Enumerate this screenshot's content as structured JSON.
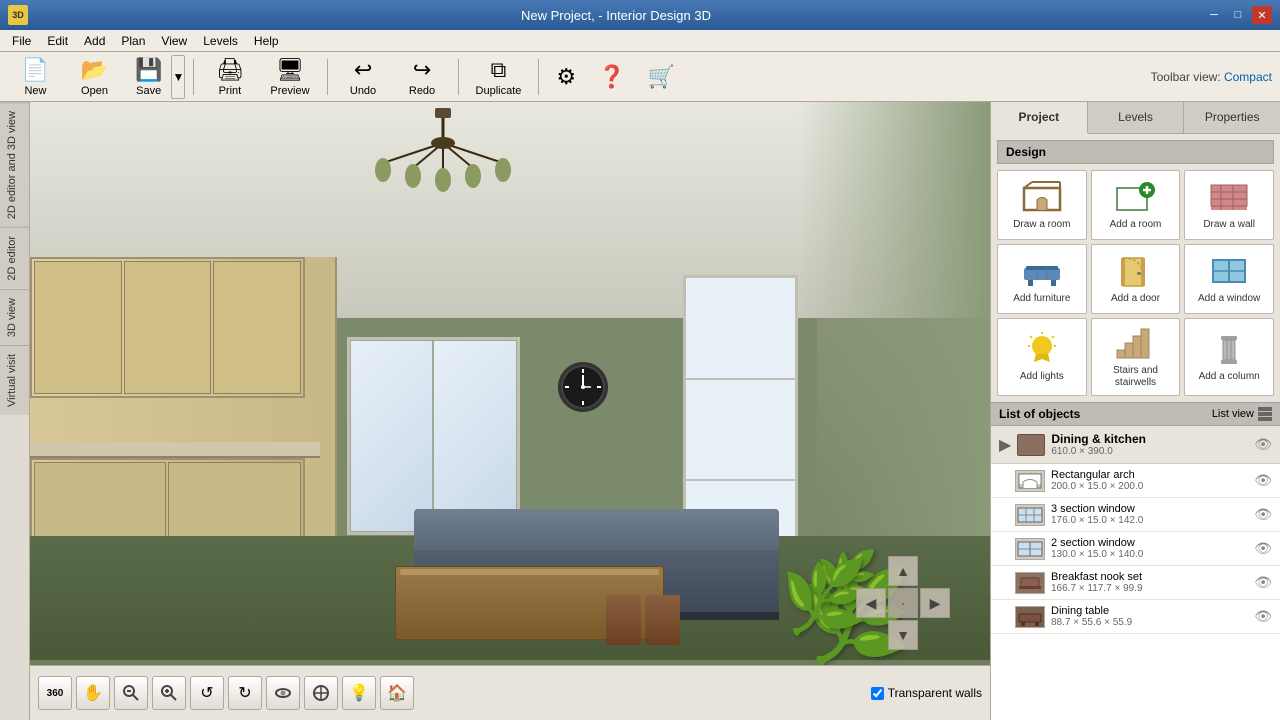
{
  "titlebar": {
    "title": "New Project, - Interior Design 3D",
    "logo_text": "3D",
    "minimize_btn": "─",
    "restore_btn": "□",
    "close_btn": "✕"
  },
  "menubar": {
    "items": [
      "File",
      "Edit",
      "Add",
      "Plan",
      "View",
      "Levels",
      "Help"
    ]
  },
  "toolbar": {
    "buttons": [
      {
        "id": "new",
        "label": "New",
        "icon": "📄"
      },
      {
        "id": "open",
        "label": "Open",
        "icon": "📂"
      },
      {
        "id": "save",
        "label": "Save",
        "icon": "💾"
      },
      {
        "id": "print",
        "label": "Print",
        "icon": "🖨"
      },
      {
        "id": "preview",
        "label": "Preview",
        "icon": "🖥"
      },
      {
        "id": "undo",
        "label": "Undo",
        "icon": "↩"
      },
      {
        "id": "redo",
        "label": "Redo",
        "icon": "↪"
      },
      {
        "id": "duplicate",
        "label": "Duplicate",
        "icon": "⧉"
      },
      {
        "id": "settings",
        "label": "",
        "icon": "⚙"
      },
      {
        "id": "help",
        "label": "",
        "icon": "❓"
      },
      {
        "id": "shop",
        "label": "",
        "icon": "🛒"
      }
    ],
    "toolbar_view_label": "Toolbar view:",
    "compact_link": "Compact"
  },
  "lefttabs": [
    "2D editor and 3D view",
    "2D editor",
    "3D view",
    "Virtual visit"
  ],
  "viewport": {
    "transparent_walls_label": "Transparent walls",
    "transparent_walls_checked": true
  },
  "viewport_toolbar": {
    "buttons": [
      {
        "id": "360",
        "icon": "360",
        "label": "360 view"
      },
      {
        "id": "pan",
        "icon": "✋",
        "label": "Pan"
      },
      {
        "id": "zoom-out",
        "icon": "🔍-",
        "label": "Zoom out"
      },
      {
        "id": "zoom-in",
        "icon": "🔍+",
        "label": "Zoom in"
      },
      {
        "id": "rotate-left",
        "icon": "↺",
        "label": "Rotate left"
      },
      {
        "id": "rotate-right",
        "icon": "↻",
        "label": "Rotate right"
      },
      {
        "id": "orbit",
        "icon": "⟳",
        "label": "Orbit"
      },
      {
        "id": "tilt",
        "icon": "⊙",
        "label": "Tilt"
      },
      {
        "id": "bulb",
        "icon": "💡",
        "label": "Lights"
      },
      {
        "id": "home",
        "icon": "🏠",
        "label": "Home"
      }
    ]
  },
  "rightpanel": {
    "tabs": [
      {
        "id": "project",
        "label": "Project",
        "active": true
      },
      {
        "id": "levels",
        "label": "Levels",
        "active": false
      },
      {
        "id": "properties",
        "label": "Properties",
        "active": false
      }
    ],
    "design_section_title": "Design",
    "design_items": [
      {
        "id": "draw-room",
        "label": "Draw a room",
        "icon": "🏠"
      },
      {
        "id": "add-room",
        "label": "Add a room",
        "icon": "➕"
      },
      {
        "id": "draw-wall",
        "label": "Draw a wall",
        "icon": "🧱"
      },
      {
        "id": "add-furniture",
        "label": "Add furniture",
        "icon": "🪑"
      },
      {
        "id": "add-door",
        "label": "Add a door",
        "icon": "🚪"
      },
      {
        "id": "add-window",
        "label": "Add a window",
        "icon": "🪟"
      },
      {
        "id": "add-lights",
        "label": "Add lights",
        "icon": "💡"
      },
      {
        "id": "stairs-stairwells",
        "label": "Stairs and stairwells",
        "icon": "🪜"
      },
      {
        "id": "add-column",
        "label": "Add a column",
        "icon": "🏛"
      }
    ],
    "objects_header_title": "List of objects",
    "list_view_label": "List view",
    "objects": [
      {
        "id": "dining-kitchen",
        "type": "category",
        "name": "Dining & kitchen",
        "dims": "610.0 × 390.0",
        "visible": true
      },
      {
        "id": "rectangular-arch",
        "type": "item",
        "name": "Rectangular arch",
        "dims": "200.0 × 15.0 × 200.0",
        "visible": true
      },
      {
        "id": "3-section-window",
        "type": "item",
        "name": "3 section window",
        "dims": "176.0 × 15.0 × 142.0",
        "visible": true
      },
      {
        "id": "2-section-window",
        "type": "item",
        "name": "2 section window",
        "dims": "130.0 × 15.0 × 140.0",
        "visible": true
      },
      {
        "id": "breakfast-nook-set",
        "type": "item",
        "name": "Breakfast nook set",
        "dims": "166.7 × 117.7 × 99.9",
        "visible": true
      },
      {
        "id": "dining-table",
        "type": "item",
        "name": "Dining table",
        "dims": "88.7 × 55.6 × 55.9",
        "visible": true
      }
    ]
  },
  "colors": {
    "accent_blue": "#4a7ab5",
    "bg_panel": "#e8e4dc",
    "bg_toolbar": "#f0ece4",
    "border": "#b0a898",
    "section_header": "#c0bbb4"
  }
}
